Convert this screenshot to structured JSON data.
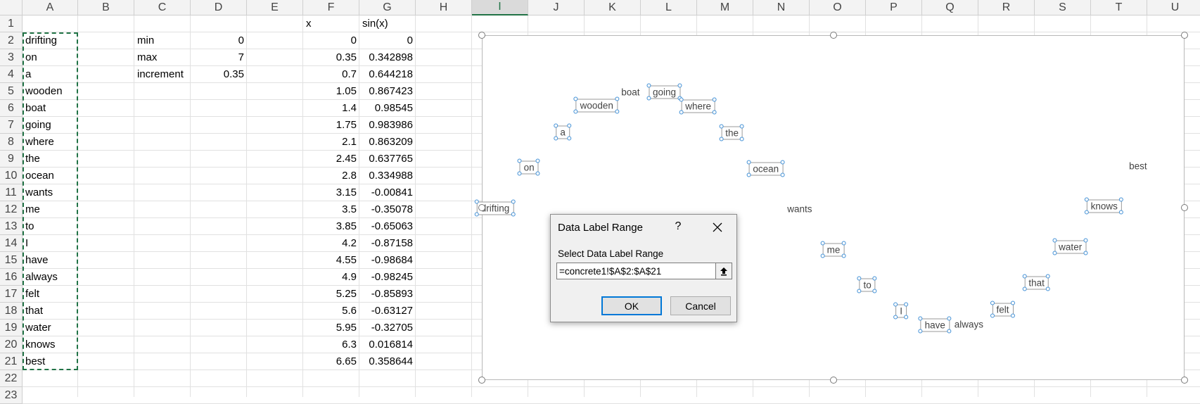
{
  "sheet": {
    "columns": [
      "A",
      "B",
      "C",
      "D",
      "E",
      "F",
      "G",
      "H",
      "I",
      "J",
      "K",
      "L",
      "M",
      "N",
      "O",
      "P",
      "Q",
      "R",
      "S",
      "T",
      "U"
    ],
    "rows": [
      "1",
      "2",
      "3",
      "4",
      "5",
      "6",
      "7",
      "8",
      "9",
      "10",
      "11",
      "12",
      "13",
      "14",
      "15",
      "16",
      "17",
      "18",
      "19",
      "20",
      "21",
      "22",
      "23"
    ],
    "active_column": "I",
    "cells": [
      {
        "ref": "F1",
        "value": "x",
        "align": "left"
      },
      {
        "ref": "G1",
        "value": "sin(x)",
        "align": "left"
      },
      {
        "ref": "C2",
        "value": "min",
        "align": "left"
      },
      {
        "ref": "D2",
        "value": "0",
        "align": "right"
      },
      {
        "ref": "C3",
        "value": "max",
        "align": "left"
      },
      {
        "ref": "D3",
        "value": "7",
        "align": "right"
      },
      {
        "ref": "C4",
        "value": "increment",
        "align": "left"
      },
      {
        "ref": "D4",
        "value": "0.35",
        "align": "right"
      },
      {
        "ref": "A2",
        "value": "drifting",
        "align": "left"
      },
      {
        "ref": "A3",
        "value": "on",
        "align": "left"
      },
      {
        "ref": "A4",
        "value": "a",
        "align": "left"
      },
      {
        "ref": "A5",
        "value": "wooden",
        "align": "left"
      },
      {
        "ref": "A6",
        "value": "boat",
        "align": "left"
      },
      {
        "ref": "A7",
        "value": "going",
        "align": "left"
      },
      {
        "ref": "A8",
        "value": "where",
        "align": "left"
      },
      {
        "ref": "A9",
        "value": "the",
        "align": "left"
      },
      {
        "ref": "A10",
        "value": "ocean",
        "align": "left"
      },
      {
        "ref": "A11",
        "value": "wants",
        "align": "left"
      },
      {
        "ref": "A12",
        "value": "me",
        "align": "left"
      },
      {
        "ref": "A13",
        "value": "to",
        "align": "left"
      },
      {
        "ref": "A14",
        "value": "I",
        "align": "left"
      },
      {
        "ref": "A15",
        "value": "have",
        "align": "left"
      },
      {
        "ref": "A16",
        "value": "always",
        "align": "left"
      },
      {
        "ref": "A17",
        "value": "felt",
        "align": "left"
      },
      {
        "ref": "A18",
        "value": "that",
        "align": "left"
      },
      {
        "ref": "A19",
        "value": "water",
        "align": "left"
      },
      {
        "ref": "A20",
        "value": "knows",
        "align": "left"
      },
      {
        "ref": "A21",
        "value": "best",
        "align": "left"
      },
      {
        "ref": "F2",
        "value": "0",
        "align": "right"
      },
      {
        "ref": "F3",
        "value": "0.35",
        "align": "right"
      },
      {
        "ref": "F4",
        "value": "0.7",
        "align": "right"
      },
      {
        "ref": "F5",
        "value": "1.05",
        "align": "right"
      },
      {
        "ref": "F6",
        "value": "1.4",
        "align": "right"
      },
      {
        "ref": "F7",
        "value": "1.75",
        "align": "right"
      },
      {
        "ref": "F8",
        "value": "2.1",
        "align": "right"
      },
      {
        "ref": "F9",
        "value": "2.45",
        "align": "right"
      },
      {
        "ref": "F10",
        "value": "2.8",
        "align": "right"
      },
      {
        "ref": "F11",
        "value": "3.15",
        "align": "right"
      },
      {
        "ref": "F12",
        "value": "3.5",
        "align": "right"
      },
      {
        "ref": "F13",
        "value": "3.85",
        "align": "right"
      },
      {
        "ref": "F14",
        "value": "4.2",
        "align": "right"
      },
      {
        "ref": "F15",
        "value": "4.55",
        "align": "right"
      },
      {
        "ref": "F16",
        "value": "4.9",
        "align": "right"
      },
      {
        "ref": "F17",
        "value": "5.25",
        "align": "right"
      },
      {
        "ref": "F18",
        "value": "5.6",
        "align": "right"
      },
      {
        "ref": "F19",
        "value": "5.95",
        "align": "right"
      },
      {
        "ref": "F20",
        "value": "6.3",
        "align": "right"
      },
      {
        "ref": "F21",
        "value": "6.65",
        "align": "right"
      },
      {
        "ref": "G2",
        "value": "0",
        "align": "right"
      },
      {
        "ref": "G3",
        "value": "0.342898",
        "align": "right"
      },
      {
        "ref": "G4",
        "value": "0.644218",
        "align": "right"
      },
      {
        "ref": "G5",
        "value": "0.867423",
        "align": "right"
      },
      {
        "ref": "G6",
        "value": "0.98545",
        "align": "right"
      },
      {
        "ref": "G7",
        "value": "0.983986",
        "align": "right"
      },
      {
        "ref": "G8",
        "value": "0.863209",
        "align": "right"
      },
      {
        "ref": "G9",
        "value": "0.637765",
        "align": "right"
      },
      {
        "ref": "G10",
        "value": "0.334988",
        "align": "right"
      },
      {
        "ref": "G11",
        "value": "-0.00841",
        "align": "right"
      },
      {
        "ref": "G12",
        "value": "-0.35078",
        "align": "right"
      },
      {
        "ref": "G13",
        "value": "-0.65063",
        "align": "right"
      },
      {
        "ref": "G14",
        "value": "-0.87158",
        "align": "right"
      },
      {
        "ref": "G15",
        "value": "-0.98684",
        "align": "right"
      },
      {
        "ref": "G16",
        "value": "-0.98245",
        "align": "right"
      },
      {
        "ref": "G17",
        "value": "-0.85893",
        "align": "right"
      },
      {
        "ref": "G18",
        "value": "-0.63127",
        "align": "right"
      },
      {
        "ref": "G19",
        "value": "-0.32705",
        "align": "right"
      },
      {
        "ref": "G20",
        "value": "0.016814",
        "align": "right"
      },
      {
        "ref": "G21",
        "value": "0.358644",
        "align": "right"
      }
    ]
  },
  "chart_data": {
    "type": "scatter",
    "x": [
      0,
      0.35,
      0.7,
      1.05,
      1.4,
      1.75,
      2.1,
      2.45,
      2.8,
      3.15,
      3.5,
      3.85,
      4.2,
      4.55,
      4.9,
      5.25,
      5.6,
      5.95,
      6.3,
      6.65
    ],
    "y": [
      0,
      0.342898,
      0.644218,
      0.867423,
      0.98545,
      0.983986,
      0.863209,
      0.637765,
      0.334988,
      -0.00841,
      -0.35078,
      -0.65063,
      -0.87158,
      -0.98684,
      -0.98245,
      -0.85893,
      -0.63127,
      -0.32705,
      0.016814,
      0.358644
    ],
    "labels": [
      "drifting",
      "on",
      "a",
      "wooden",
      "boat",
      "going",
      "where",
      "the",
      "ocean",
      "wants",
      "me",
      "to",
      "I",
      "have",
      "always",
      "felt",
      "that",
      "water",
      "knows",
      "best"
    ],
    "selected_labels": [
      true,
      true,
      true,
      true,
      false,
      true,
      true,
      true,
      true,
      false,
      true,
      true,
      true,
      true,
      false,
      true,
      true,
      true,
      true,
      false
    ],
    "xlim": [
      0,
      7
    ],
    "ylim": [
      -1.4,
      1.4
    ],
    "selected": true
  },
  "dialog": {
    "title": "Data Label Range",
    "help": "?",
    "prompt": "Select Data Label Range",
    "input_value": "=concrete1!$A$2:$A$21",
    "ok_label": "OK",
    "cancel_label": "Cancel"
  },
  "colors": {
    "selection_green": "#217346",
    "label_handle_blue": "#3f8fd6",
    "ok_focus_blue": "#0078d7"
  }
}
